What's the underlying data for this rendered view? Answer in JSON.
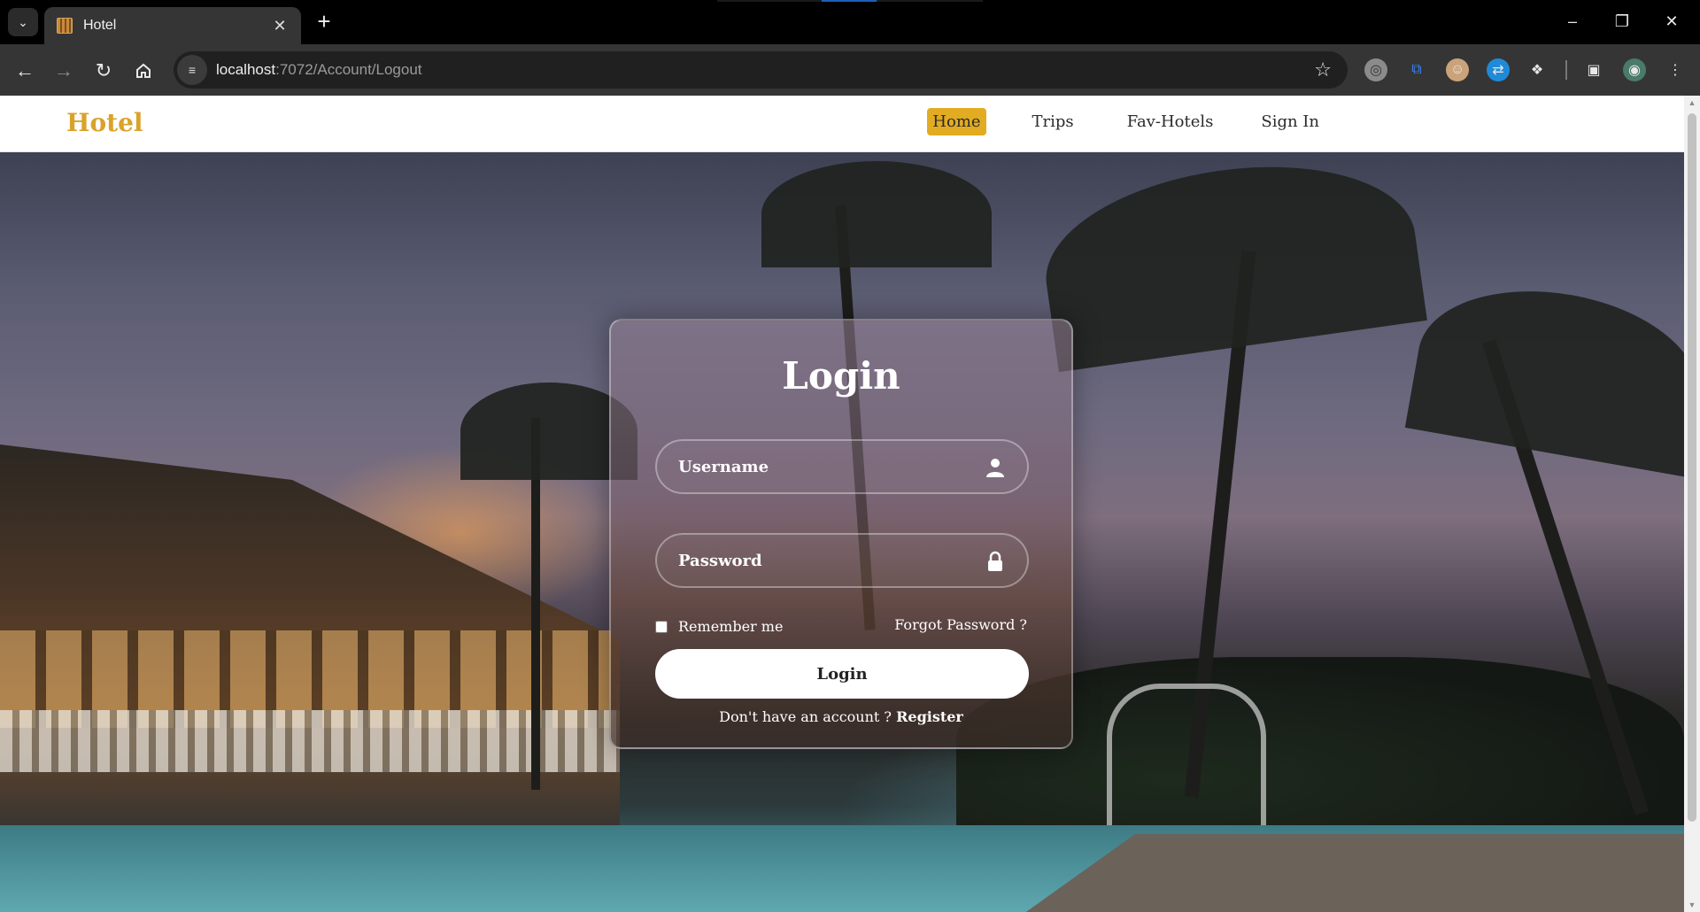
{
  "browser": {
    "tab_title": "Hotel",
    "tab_favicon": "hotel-favicon",
    "url_host": "localhost",
    "url_path": ":7072/Account/Logout"
  },
  "header": {
    "logo": "Hotel",
    "nav": [
      {
        "label": "Home",
        "active": true
      },
      {
        "label": "Trips"
      },
      {
        "label": "Fav-Hotels"
      },
      {
        "label": "Sign In"
      }
    ],
    "accent_color": "#e2ac22"
  },
  "login": {
    "title": "Login",
    "username_placeholder": "Username",
    "password_placeholder": "Password",
    "remember_label": "Remember me",
    "forgot_label": "Forgot Password ?",
    "submit_label": "Login",
    "register_prompt": "Don't have an account ?",
    "register_link": "Register"
  }
}
